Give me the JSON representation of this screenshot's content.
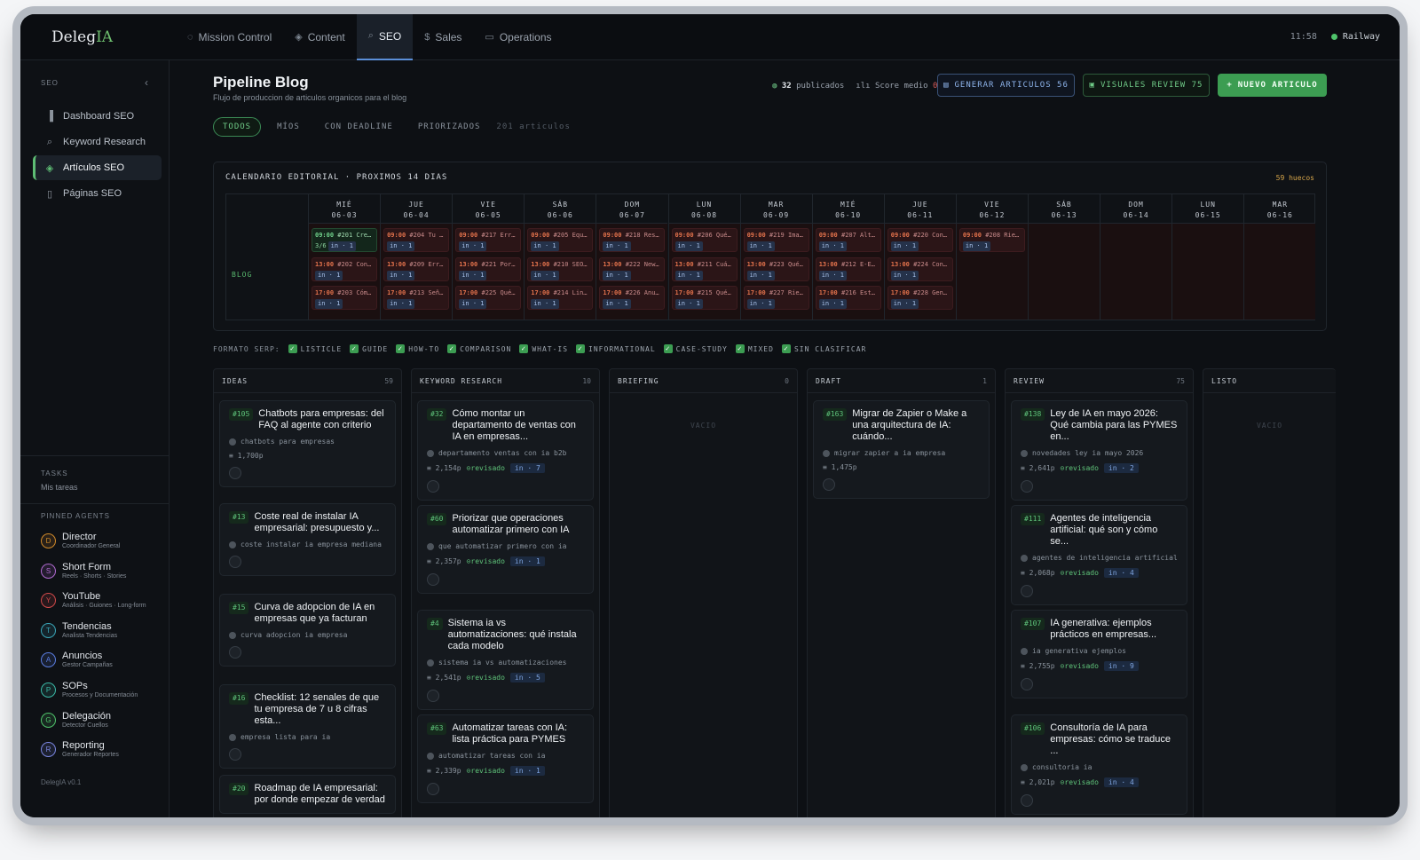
{
  "app": {
    "logo_prefix": "Deleg",
    "logo_suffix": "IA",
    "time": "11:58",
    "server": "Railway"
  },
  "nav": [
    {
      "label": "Mission Control",
      "icon": "◌"
    },
    {
      "label": "Content",
      "icon": "◈"
    },
    {
      "label": "SEO",
      "icon": "⌕"
    },
    {
      "label": "Sales",
      "icon": "$"
    },
    {
      "label": "Operations",
      "icon": "▭"
    }
  ],
  "sidebar": {
    "section": "SEO",
    "items": [
      {
        "label": "Dashboard SEO",
        "icon": "chart-icon"
      },
      {
        "label": "Keyword Research",
        "icon": "search-icon"
      },
      {
        "label": "Artículos SEO",
        "icon": "layers-icon"
      },
      {
        "label": "Páginas SEO",
        "icon": "file-icon"
      }
    ],
    "tasks_label": "TASKS",
    "tasks_sub": "Mis tareas",
    "pinned_label": "PINNED AGENTS",
    "version": "DelegIA v0.1",
    "agents": [
      {
        "i": "D",
        "name": "Director",
        "sub": "Coordinador General",
        "color": "#d08a2a"
      },
      {
        "i": "S",
        "name": "Short Form",
        "sub": "Reels · Shorts · Stories",
        "color": "#b06ad0"
      },
      {
        "i": "Y",
        "name": "YouTube",
        "sub": "Análisis · Guiones · Long-form",
        "color": "#d04a4a"
      },
      {
        "i": "T",
        "name": "Tendencias",
        "sub": "Analista Tendencias",
        "color": "#3aa6b8"
      },
      {
        "i": "A",
        "name": "Anuncios",
        "sub": "Gestor Campañas",
        "color": "#5a7de0"
      },
      {
        "i": "P",
        "name": "SOPs",
        "sub": "Procesos y Documentación",
        "color": "#3ab8a6"
      },
      {
        "i": "G",
        "name": "Delegación",
        "sub": "Detector Cuellos",
        "color": "#4fc36b"
      },
      {
        "i": "R",
        "name": "Reporting",
        "sub": "Generador Reportes",
        "color": "#7a86e0"
      }
    ]
  },
  "header": {
    "title": "Pipeline Blog",
    "subtitle": "Flujo de produccion de articulos organicos para el blog",
    "published_count": "32",
    "published_label": "publicados",
    "score_label": "Score medio",
    "score_value": "0",
    "btn_generate": "GENERAR ARTICULOS 56",
    "btn_visuals": "VISUALES REVIEW 75",
    "btn_new": "NUEVO ARTICULO"
  },
  "filters": {
    "tabs": [
      "TODOS",
      "MÍOS",
      "CON DEADLINE",
      "PRIORIZADOS"
    ],
    "count": "201 articulos"
  },
  "calendar": {
    "title": "CALENDARIO EDITORIAL · PROXIMOS 14 DIAS",
    "gaps": "59 huecos",
    "row_label": "BLOG",
    "days": [
      {
        "d": "MIÉ",
        "date": "06-03",
        "slots": [
          {
            "t": "09:00",
            "x": "#201 Cre…",
            "tag": "in · 1",
            "frac": "3/6",
            "pub": true
          },
          {
            "t": "13:00",
            "x": "#202 Con…",
            "tag": "in · 1"
          },
          {
            "t": "17:00",
            "x": "#203 Cóm…",
            "tag": "in · 1"
          }
        ]
      },
      {
        "d": "JUE",
        "date": "06-04",
        "slots": [
          {
            "t": "09:00",
            "x": "#204 Tu …",
            "tag": "in · 1"
          },
          {
            "t": "13:00",
            "x": "#209 Err…",
            "tag": "in · 1"
          },
          {
            "t": "17:00",
            "x": "#213 Señ…",
            "tag": "in · 1"
          }
        ]
      },
      {
        "d": "VIE",
        "date": "06-05",
        "slots": [
          {
            "t": "09:00",
            "x": "#217 Err…",
            "tag": "in · 1"
          },
          {
            "t": "13:00",
            "x": "#221 Por…",
            "tag": "in · 1"
          },
          {
            "t": "17:00",
            "x": "#225 Qué…",
            "tag": "in · 1"
          }
        ]
      },
      {
        "d": "SÁB",
        "date": "06-06",
        "slots": [
          {
            "t": "09:00",
            "x": "#205 Equ…",
            "tag": "in · 1"
          },
          {
            "t": "13:00",
            "x": "#210 SEO…",
            "tag": "in · 1"
          },
          {
            "t": "17:00",
            "x": "#214 Lin…",
            "tag": "in · 1"
          }
        ]
      },
      {
        "d": "DOM",
        "date": "06-07",
        "slots": [
          {
            "t": "09:00",
            "x": "#218 Res…",
            "tag": "in · 1"
          },
          {
            "t": "13:00",
            "x": "#222 New…",
            "tag": "in · 1"
          },
          {
            "t": "17:00",
            "x": "#226 Anu…",
            "tag": "in · 1"
          }
        ]
      },
      {
        "d": "LUN",
        "date": "06-08",
        "slots": [
          {
            "t": "09:00",
            "x": "#206 Qué…",
            "tag": "in · 1"
          },
          {
            "t": "13:00",
            "x": "#211 Cuá…",
            "tag": "in · 1"
          },
          {
            "t": "17:00",
            "x": "#215 Qué…",
            "tag": "in · 1"
          }
        ]
      },
      {
        "d": "MAR",
        "date": "06-09",
        "slots": [
          {
            "t": "09:00",
            "x": "#219 Ima…",
            "tag": "in · 1"
          },
          {
            "t": "13:00",
            "x": "#223 Qué…",
            "tag": "in · 1"
          },
          {
            "t": "17:00",
            "x": "#227 Rie…",
            "tag": "in · 1"
          }
        ]
      },
      {
        "d": "MIÉ",
        "date": "06-10",
        "slots": [
          {
            "t": "09:00",
            "x": "#207 Alt…",
            "tag": "in · 1"
          },
          {
            "t": "13:00",
            "x": "#212 E-E…",
            "tag": "in · 1"
          },
          {
            "t": "17:00",
            "x": "#216 Est…",
            "tag": "in · 1"
          }
        ]
      },
      {
        "d": "JUE",
        "date": "06-11",
        "slots": [
          {
            "t": "09:00",
            "x": "#220 Con…",
            "tag": "in · 1"
          },
          {
            "t": "13:00",
            "x": "#224 Con…",
            "tag": "in · 1"
          },
          {
            "t": "17:00",
            "x": "#228 Gen…",
            "tag": "in · 1"
          }
        ]
      },
      {
        "d": "VIE",
        "date": "06-12",
        "slots": [
          {
            "t": "09:00",
            "x": "#208 Rie…",
            "tag": "in · 1"
          }
        ]
      },
      {
        "d": "SÁB",
        "date": "06-13",
        "slots": []
      },
      {
        "d": "DOM",
        "date": "06-14",
        "slots": []
      },
      {
        "d": "LUN",
        "date": "06-15",
        "slots": []
      },
      {
        "d": "MAR",
        "date": "06-16",
        "slots": []
      }
    ]
  },
  "serp": {
    "label": "FORMATO SERP:",
    "options": [
      "LISTICLE",
      "GUIDE",
      "HOW-TO",
      "COMPARISON",
      "WHAT-IS",
      "INFORMATIONAL",
      "CASE-STUDY",
      "MIXED",
      "SIN CLASIFICAR"
    ]
  },
  "columns": [
    {
      "name": "IDEAS",
      "count": "59",
      "cards": [
        {
          "id": "#105",
          "title": "Chatbots para empresas: del FAQ al agente con criterio",
          "kw": "chatbots para empresas",
          "words": "1,700p"
        },
        {
          "id": "#13",
          "title": "Coste real de instalar IA empresarial: presupuesto y...",
          "kw": "coste instalar ia empresa mediana"
        },
        {
          "id": "#15",
          "title": "Curva de adopcion de IA en empresas que ya facturan",
          "kw": "curva adopcion ia empresa"
        },
        {
          "id": "#16",
          "title": "Checklist: 12 senales de que tu empresa de 7 u 8 cifras esta...",
          "kw": "empresa lista para ia"
        },
        {
          "id": "#20",
          "title": "Roadmap de IA empresarial: por donde empezar de verdad",
          "kw": ""
        }
      ]
    },
    {
      "name": "KEYWORD RESEARCH",
      "count": "10",
      "cards": [
        {
          "id": "#32",
          "title": "Cómo montar un departamento de ventas con IA en empresas...",
          "kw": "departamento ventas con ia b2b",
          "words": "2,154p",
          "rev": "revisado",
          "tag": "in · 7"
        },
        {
          "id": "#60",
          "title": "Priorizar que operaciones automatizar primero con IA",
          "kw": "que automatizar primero con ia",
          "words": "2,357p",
          "rev": "revisado",
          "tag": "in · 1"
        },
        {
          "id": "#4",
          "title": "Sistema ia vs automatizaciones: qué instala cada modelo",
          "kw": "sistema ia vs automatizaciones",
          "words": "2,541p",
          "rev": "revisado",
          "tag": "in · 5"
        },
        {
          "id": "#63",
          "title": "Automatizar tareas con IA: lista práctica para PYMES",
          "kw": "automatizar tareas con ia",
          "words": "2,339p",
          "rev": "revisado",
          "tag": "in · 1"
        }
      ]
    },
    {
      "name": "BRIEFING",
      "count": "0",
      "empty": "VACIO",
      "cards": []
    },
    {
      "name": "DRAFT",
      "count": "1",
      "cards": [
        {
          "id": "#163",
          "title": "Migrar de Zapier o Make a una arquitectura de IA: cuándo...",
          "kw": "migrar zapier a ia empresa",
          "words": "1,475p"
        }
      ]
    },
    {
      "name": "REVIEW",
      "count": "75",
      "cards": [
        {
          "id": "#138",
          "title": "Ley de IA en mayo 2026: Qué cambia para las PYMES en...",
          "kw": "novedades ley ia mayo 2026",
          "words": "2,641p",
          "rev": "revisado",
          "tag": "in · 2"
        },
        {
          "id": "#111",
          "title": "Agentes de inteligencia artificial: qué son y cómo se...",
          "kw": "agentes de inteligencia artificial",
          "words": "2,068p",
          "rev": "revisado",
          "tag": "in · 4"
        },
        {
          "id": "#107",
          "title": "IA generativa: ejemplos prácticos en empresas...",
          "kw": "ia generativa ejemplos",
          "words": "2,755p",
          "rev": "revisado",
          "tag": "in · 9"
        },
        {
          "id": "#106",
          "title": "Consultoría de IA para empresas: cómo se traduce ...",
          "kw": "consultoria ia",
          "words": "2,021p",
          "rev": "revisado",
          "tag": "in · 4"
        }
      ]
    },
    {
      "name": "LISTO",
      "count": "",
      "empty": "VACIO",
      "cards": []
    }
  ]
}
